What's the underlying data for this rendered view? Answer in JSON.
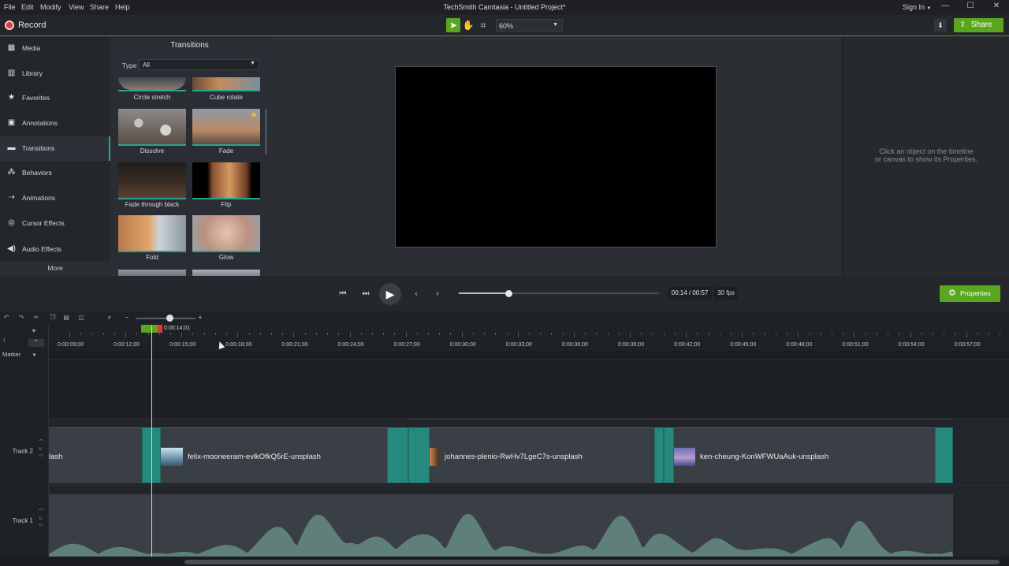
{
  "menu": [
    "File",
    "Edit",
    "Modify",
    "View",
    "Share",
    "Help"
  ],
  "app_title": "TechSmith Camtasia - Untitled Project*",
  "sign_in": "Sign In",
  "record": "Record",
  "zoom": "60%",
  "share": "Share",
  "nav": {
    "items": [
      "Media",
      "Library",
      "Favorites",
      "Annotations",
      "Transitions",
      "Behaviors",
      "Animations",
      "Cursor Effects",
      "Audio Effects"
    ],
    "active": "Transitions",
    "more": "More"
  },
  "transitions": {
    "title": "Transitions",
    "type_label": "Type",
    "type_value": "All",
    "items": [
      "Circle stretch",
      "Cube rotate",
      "Dissolve",
      "Fade",
      "Fade through black",
      "Flip",
      "Fold",
      "Glow"
    ]
  },
  "properties_hint": [
    "Click an object on the timeline",
    "or canvas to show its Properties."
  ],
  "playback": {
    "time": "00:14 / 00:57",
    "fps": "30 fps",
    "progress": 0.246
  },
  "properties_button": "Properties",
  "timeline": {
    "playhead_time": "0:00:14;01",
    "ruler": [
      "0:00:09;00",
      "0:00:12;00",
      "0:00:15;00",
      "0:00:18;00",
      "0:00:21;00",
      "0:00:24;00",
      "0:00:27;00",
      "0:00:30;00",
      "0:00:33;00",
      "0:00:36;00",
      "0:00:39;00",
      "0:00:42;00",
      "0:00:45;00",
      "0:00:48;00",
      "0:00:51;00",
      "0:00:54;00",
      "0:00:57;00"
    ],
    "marker": "Marker",
    "track2": "Track 2",
    "track1": "Track 1",
    "clips": [
      "lash",
      "felix-mooneeram-evlkOfkQ5rE-unsplash",
      "johannes-plenio-RwHv7LgeC7s-unsplash",
      "ken-cheung-KonWFWUaAuk-unsplash"
    ]
  },
  "colors": {
    "accent": "#5ba61f",
    "transition": "#26897e",
    "record": "#e0383b"
  }
}
